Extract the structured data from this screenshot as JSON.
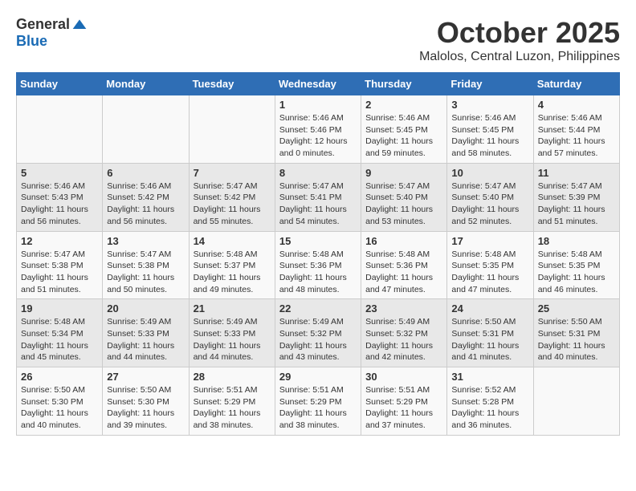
{
  "header": {
    "logo_general": "General",
    "logo_blue": "Blue",
    "month": "October 2025",
    "location": "Malolos, Central Luzon, Philippines"
  },
  "days_of_week": [
    "Sunday",
    "Monday",
    "Tuesday",
    "Wednesday",
    "Thursday",
    "Friday",
    "Saturday"
  ],
  "weeks": [
    [
      {
        "day": "",
        "sunrise": "",
        "sunset": "",
        "daylight": ""
      },
      {
        "day": "",
        "sunrise": "",
        "sunset": "",
        "daylight": ""
      },
      {
        "day": "",
        "sunrise": "",
        "sunset": "",
        "daylight": ""
      },
      {
        "day": "1",
        "sunrise": "Sunrise: 5:46 AM",
        "sunset": "Sunset: 5:46 PM",
        "daylight": "Daylight: 12 hours and 0 minutes."
      },
      {
        "day": "2",
        "sunrise": "Sunrise: 5:46 AM",
        "sunset": "Sunset: 5:45 PM",
        "daylight": "Daylight: 11 hours and 59 minutes."
      },
      {
        "day": "3",
        "sunrise": "Sunrise: 5:46 AM",
        "sunset": "Sunset: 5:45 PM",
        "daylight": "Daylight: 11 hours and 58 minutes."
      },
      {
        "day": "4",
        "sunrise": "Sunrise: 5:46 AM",
        "sunset": "Sunset: 5:44 PM",
        "daylight": "Daylight: 11 hours and 57 minutes."
      }
    ],
    [
      {
        "day": "5",
        "sunrise": "Sunrise: 5:46 AM",
        "sunset": "Sunset: 5:43 PM",
        "daylight": "Daylight: 11 hours and 56 minutes."
      },
      {
        "day": "6",
        "sunrise": "Sunrise: 5:46 AM",
        "sunset": "Sunset: 5:42 PM",
        "daylight": "Daylight: 11 hours and 56 minutes."
      },
      {
        "day": "7",
        "sunrise": "Sunrise: 5:47 AM",
        "sunset": "Sunset: 5:42 PM",
        "daylight": "Daylight: 11 hours and 55 minutes."
      },
      {
        "day": "8",
        "sunrise": "Sunrise: 5:47 AM",
        "sunset": "Sunset: 5:41 PM",
        "daylight": "Daylight: 11 hours and 54 minutes."
      },
      {
        "day": "9",
        "sunrise": "Sunrise: 5:47 AM",
        "sunset": "Sunset: 5:40 PM",
        "daylight": "Daylight: 11 hours and 53 minutes."
      },
      {
        "day": "10",
        "sunrise": "Sunrise: 5:47 AM",
        "sunset": "Sunset: 5:40 PM",
        "daylight": "Daylight: 11 hours and 52 minutes."
      },
      {
        "day": "11",
        "sunrise": "Sunrise: 5:47 AM",
        "sunset": "Sunset: 5:39 PM",
        "daylight": "Daylight: 11 hours and 51 minutes."
      }
    ],
    [
      {
        "day": "12",
        "sunrise": "Sunrise: 5:47 AM",
        "sunset": "Sunset: 5:38 PM",
        "daylight": "Daylight: 11 hours and 51 minutes."
      },
      {
        "day": "13",
        "sunrise": "Sunrise: 5:47 AM",
        "sunset": "Sunset: 5:38 PM",
        "daylight": "Daylight: 11 hours and 50 minutes."
      },
      {
        "day": "14",
        "sunrise": "Sunrise: 5:48 AM",
        "sunset": "Sunset: 5:37 PM",
        "daylight": "Daylight: 11 hours and 49 minutes."
      },
      {
        "day": "15",
        "sunrise": "Sunrise: 5:48 AM",
        "sunset": "Sunset: 5:36 PM",
        "daylight": "Daylight: 11 hours and 48 minutes."
      },
      {
        "day": "16",
        "sunrise": "Sunrise: 5:48 AM",
        "sunset": "Sunset: 5:36 PM",
        "daylight": "Daylight: 11 hours and 47 minutes."
      },
      {
        "day": "17",
        "sunrise": "Sunrise: 5:48 AM",
        "sunset": "Sunset: 5:35 PM",
        "daylight": "Daylight: 11 hours and 47 minutes."
      },
      {
        "day": "18",
        "sunrise": "Sunrise: 5:48 AM",
        "sunset": "Sunset: 5:35 PM",
        "daylight": "Daylight: 11 hours and 46 minutes."
      }
    ],
    [
      {
        "day": "19",
        "sunrise": "Sunrise: 5:48 AM",
        "sunset": "Sunset: 5:34 PM",
        "daylight": "Daylight: 11 hours and 45 minutes."
      },
      {
        "day": "20",
        "sunrise": "Sunrise: 5:49 AM",
        "sunset": "Sunset: 5:33 PM",
        "daylight": "Daylight: 11 hours and 44 minutes."
      },
      {
        "day": "21",
        "sunrise": "Sunrise: 5:49 AM",
        "sunset": "Sunset: 5:33 PM",
        "daylight": "Daylight: 11 hours and 44 minutes."
      },
      {
        "day": "22",
        "sunrise": "Sunrise: 5:49 AM",
        "sunset": "Sunset: 5:32 PM",
        "daylight": "Daylight: 11 hours and 43 minutes."
      },
      {
        "day": "23",
        "sunrise": "Sunrise: 5:49 AM",
        "sunset": "Sunset: 5:32 PM",
        "daylight": "Daylight: 11 hours and 42 minutes."
      },
      {
        "day": "24",
        "sunrise": "Sunrise: 5:50 AM",
        "sunset": "Sunset: 5:31 PM",
        "daylight": "Daylight: 11 hours and 41 minutes."
      },
      {
        "day": "25",
        "sunrise": "Sunrise: 5:50 AM",
        "sunset": "Sunset: 5:31 PM",
        "daylight": "Daylight: 11 hours and 40 minutes."
      }
    ],
    [
      {
        "day": "26",
        "sunrise": "Sunrise: 5:50 AM",
        "sunset": "Sunset: 5:30 PM",
        "daylight": "Daylight: 11 hours and 40 minutes."
      },
      {
        "day": "27",
        "sunrise": "Sunrise: 5:50 AM",
        "sunset": "Sunset: 5:30 PM",
        "daylight": "Daylight: 11 hours and 39 minutes."
      },
      {
        "day": "28",
        "sunrise": "Sunrise: 5:51 AM",
        "sunset": "Sunset: 5:29 PM",
        "daylight": "Daylight: 11 hours and 38 minutes."
      },
      {
        "day": "29",
        "sunrise": "Sunrise: 5:51 AM",
        "sunset": "Sunset: 5:29 PM",
        "daylight": "Daylight: 11 hours and 38 minutes."
      },
      {
        "day": "30",
        "sunrise": "Sunrise: 5:51 AM",
        "sunset": "Sunset: 5:29 PM",
        "daylight": "Daylight: 11 hours and 37 minutes."
      },
      {
        "day": "31",
        "sunrise": "Sunrise: 5:52 AM",
        "sunset": "Sunset: 5:28 PM",
        "daylight": "Daylight: 11 hours and 36 minutes."
      },
      {
        "day": "",
        "sunrise": "",
        "sunset": "",
        "daylight": ""
      }
    ]
  ]
}
